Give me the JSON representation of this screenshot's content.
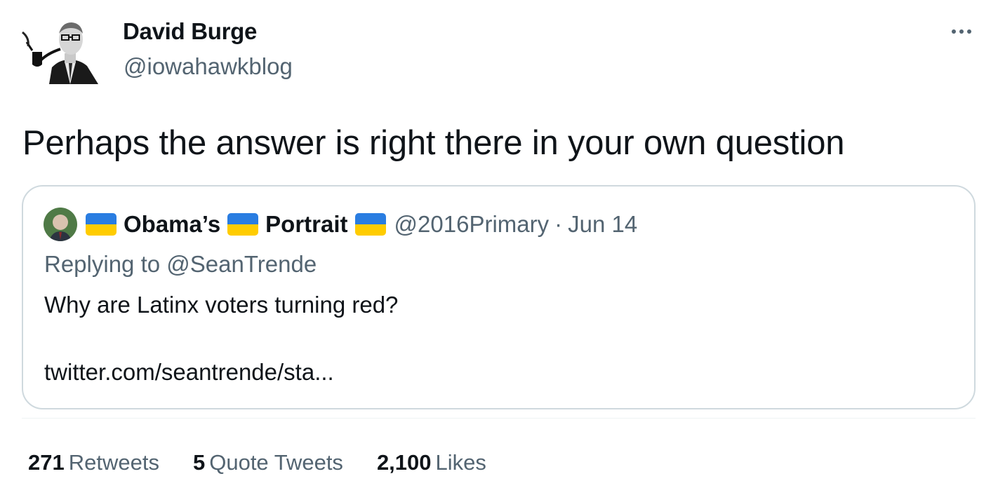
{
  "author": {
    "name": "David Burge",
    "handle": "@iowahawkblog"
  },
  "tweet_text": "Perhaps the answer is right there in your own question",
  "quoted": {
    "name_parts": [
      "Obama’s",
      "Portrait"
    ],
    "handle": "@2016Primary",
    "separator": "·",
    "date": "Jun 14",
    "replying_prefix": "Replying to",
    "replying_to": "@SeanTrende",
    "body": "Why are Latinx voters turning red?",
    "link": "twitter.com/seantrende/sta..."
  },
  "stats": {
    "retweets_count": "271",
    "retweets_label": "Retweets",
    "quotes_count": "5",
    "quotes_label": "Quote Tweets",
    "likes_count": "2,100",
    "likes_label": "Likes"
  },
  "colors": {
    "text": "#0f1419",
    "secondary": "#536471",
    "border": "#cfd9de",
    "flag_blue": "#2a7de1",
    "flag_yellow": "#ffcc00"
  }
}
